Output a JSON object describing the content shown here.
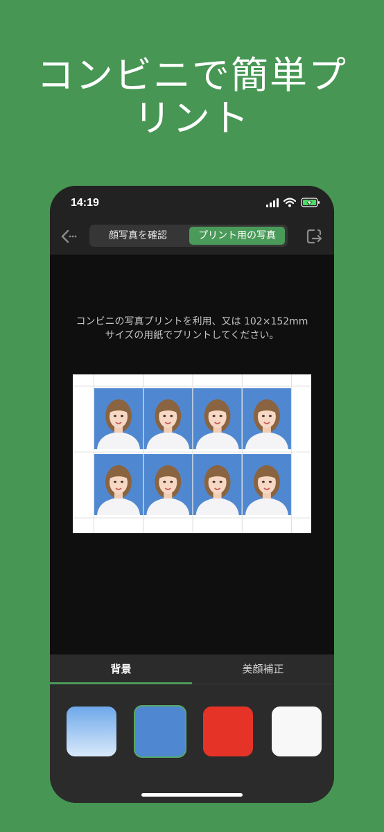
{
  "headline": {
    "line1": "コンビニで簡単プ",
    "line2": "リント"
  },
  "status_bar": {
    "time": "14:19",
    "icons": [
      "cellular-signal-icon",
      "wifi-icon",
      "battery-charging-icon"
    ]
  },
  "nav": {
    "back_icon": "back-arrow-icon",
    "segments": [
      {
        "label": "顔写真を確認",
        "selected": false
      },
      {
        "label": "プリント用の写真",
        "selected": true
      }
    ],
    "export_icon": "export-icon"
  },
  "content": {
    "instruction": "コンビニの写真プリントを利用、又は 102×152mm サイズの用紙でプリントしてください。",
    "photo_sheet": {
      "rows": 2,
      "columns": 4,
      "photo_background": "#4f88d1"
    }
  },
  "bottom_tabs": [
    {
      "label": "背景",
      "selected": true
    },
    {
      "label": "美顔補正",
      "selected": false
    }
  ],
  "background_colors": [
    {
      "name": "light-blue-gradient",
      "color": "#6ea8ea",
      "selected": false
    },
    {
      "name": "blue",
      "color": "#4f88d1",
      "selected": true
    },
    {
      "name": "red",
      "color": "#e53427",
      "selected": false
    },
    {
      "name": "white",
      "color": "#f8f8f8",
      "selected": false
    }
  ],
  "colors": {
    "page_background": "#479654",
    "accent": "#4a9a59",
    "phone_background": "#0f0f0f"
  }
}
